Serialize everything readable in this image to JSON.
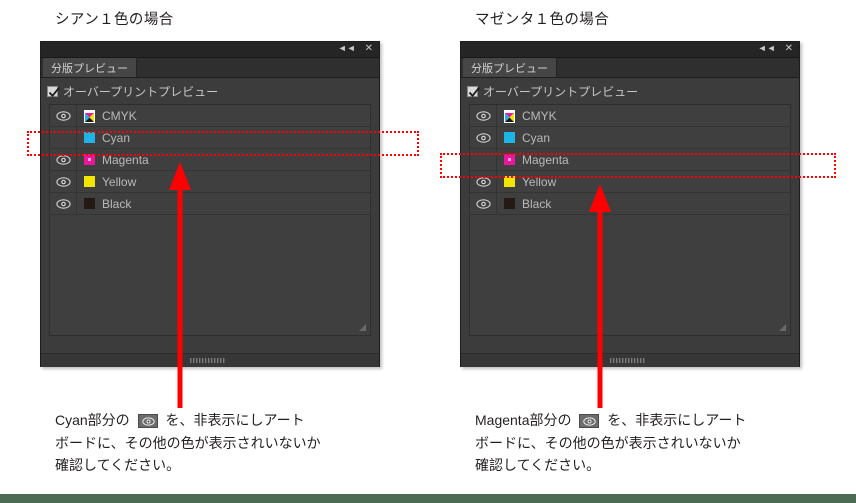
{
  "columns": [
    {
      "heading": "シアン１色の場合",
      "panel": {
        "tab_label": "分版プレビュー",
        "overprint_label": "オーバープリントプレビュー",
        "overprint_checked": true,
        "collapse_icon": "double-chevron-left-icon",
        "close_icon": "close-icon",
        "inks": [
          {
            "name": "CMYK",
            "visible": true,
            "swatch": "cmyk",
            "color": "#ffffff"
          },
          {
            "name": "Cyan",
            "visible": false,
            "swatch": "cyan",
            "color": "#1fb4e8"
          },
          {
            "name": "Magenta",
            "visible": true,
            "swatch": "magenta",
            "color": "#e6189b"
          },
          {
            "name": "Yellow",
            "visible": true,
            "swatch": "yellow",
            "color": "#f2e500"
          },
          {
            "name": "Black",
            "visible": true,
            "swatch": "black",
            "color": "#231a16"
          }
        ],
        "highlight_row": "Cyan"
      },
      "caption": {
        "line1_prefix": "Cyan部分の",
        "line1_suffix": "を、非表示にしアート",
        "line2": "ボードに、その他の色が表示されいないか",
        "line3": "確認してください。"
      }
    },
    {
      "heading": "マゼンタ１色の場合",
      "panel": {
        "tab_label": "分版プレビュー",
        "overprint_label": "オーバープリントプレビュー",
        "overprint_checked": true,
        "collapse_icon": "double-chevron-left-icon",
        "close_icon": "close-icon",
        "inks": [
          {
            "name": "CMYK",
            "visible": true,
            "swatch": "cmyk",
            "color": "#ffffff"
          },
          {
            "name": "Cyan",
            "visible": true,
            "swatch": "cyan",
            "color": "#1fb4e8"
          },
          {
            "name": "Magenta",
            "visible": false,
            "swatch": "magenta",
            "color": "#e6189b"
          },
          {
            "name": "Yellow",
            "visible": true,
            "swatch": "yellow",
            "color": "#f2e500"
          },
          {
            "name": "Black",
            "visible": true,
            "swatch": "black",
            "color": "#231a16"
          }
        ],
        "highlight_row": "Magenta"
      },
      "caption": {
        "line1_prefix": "Magenta部分の",
        "line1_suffix": "を、非表示にしアート",
        "line2": "ボードに、その他の色が表示されいないか",
        "line3": "確認してください。"
      }
    }
  ],
  "colors": {
    "highlight": "#ff0000",
    "arrow": "#ff0000",
    "bottom_bar": "#4b6b52",
    "panel_bg": "#3c3c3c",
    "panel_titlebar": "#252525",
    "text": "#231f20"
  }
}
